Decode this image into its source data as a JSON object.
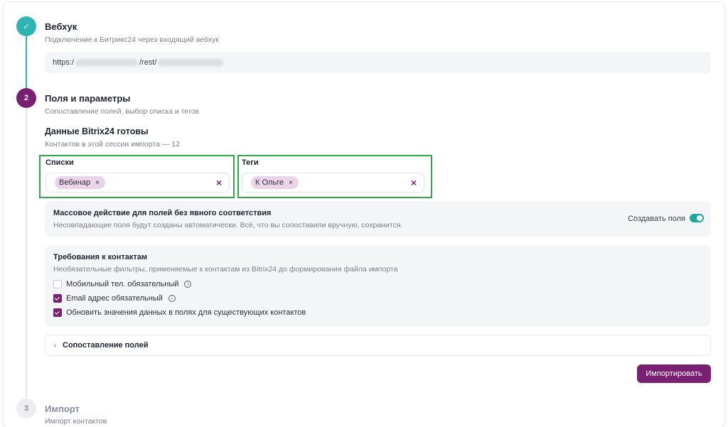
{
  "steps": [
    {
      "number": "✓",
      "title": "Вебхук",
      "subtitle": "Подключение к Битрикс24 через входящий вебхук"
    },
    {
      "number": "2",
      "title": "Поля и параметры",
      "subtitle": "Сопоставление полей, выбор списка и тегов"
    },
    {
      "number": "3",
      "title": "Импорт",
      "subtitle": "Импорт контактов"
    }
  ],
  "webhook": {
    "prefix": "https:/",
    "middle": "/rest/"
  },
  "data_ready": {
    "title": "Данные Bitrix24 готовы",
    "subtitle": "Контактов в этой сессии импорта — 12"
  },
  "lists": {
    "label": "Списки",
    "chips": [
      "Вебинар"
    ],
    "chip_remove": "×",
    "clear": "×"
  },
  "tags": {
    "label": "Теги",
    "chips": [
      "К Ольге"
    ],
    "chip_remove": "×",
    "clear": "×"
  },
  "mass_action": {
    "title": "Массовое действие для полей без явного соответствия",
    "subtitle": "Несовпадающие поля будут созданы автоматически. Всё, что вы сопоставили вручную, сохранится.",
    "toggle_label": "Создавать поля",
    "toggle_on": true
  },
  "requirements": {
    "title": "Требования к контактам",
    "subtitle": "Необязательные фильтры, применяемые к контактам из Bitrix24 до формирования файла импорта",
    "options": [
      {
        "label": "Мобильный тел. обязательный",
        "checked": false
      },
      {
        "label": "Email адрес обязательный",
        "checked": true
      },
      {
        "label": "Обновить значения данных в полях для существующих контактов",
        "checked": true
      }
    ],
    "info_glyph": "i"
  },
  "mapping": {
    "chevron": "›",
    "label": "Сопоставление полей"
  },
  "import_button": "Импортировать",
  "colors": {
    "accent": "#7b1f72",
    "done": "#2fb3b3",
    "highlight": "#2ea84b",
    "toggle": "#1aa7a0"
  }
}
